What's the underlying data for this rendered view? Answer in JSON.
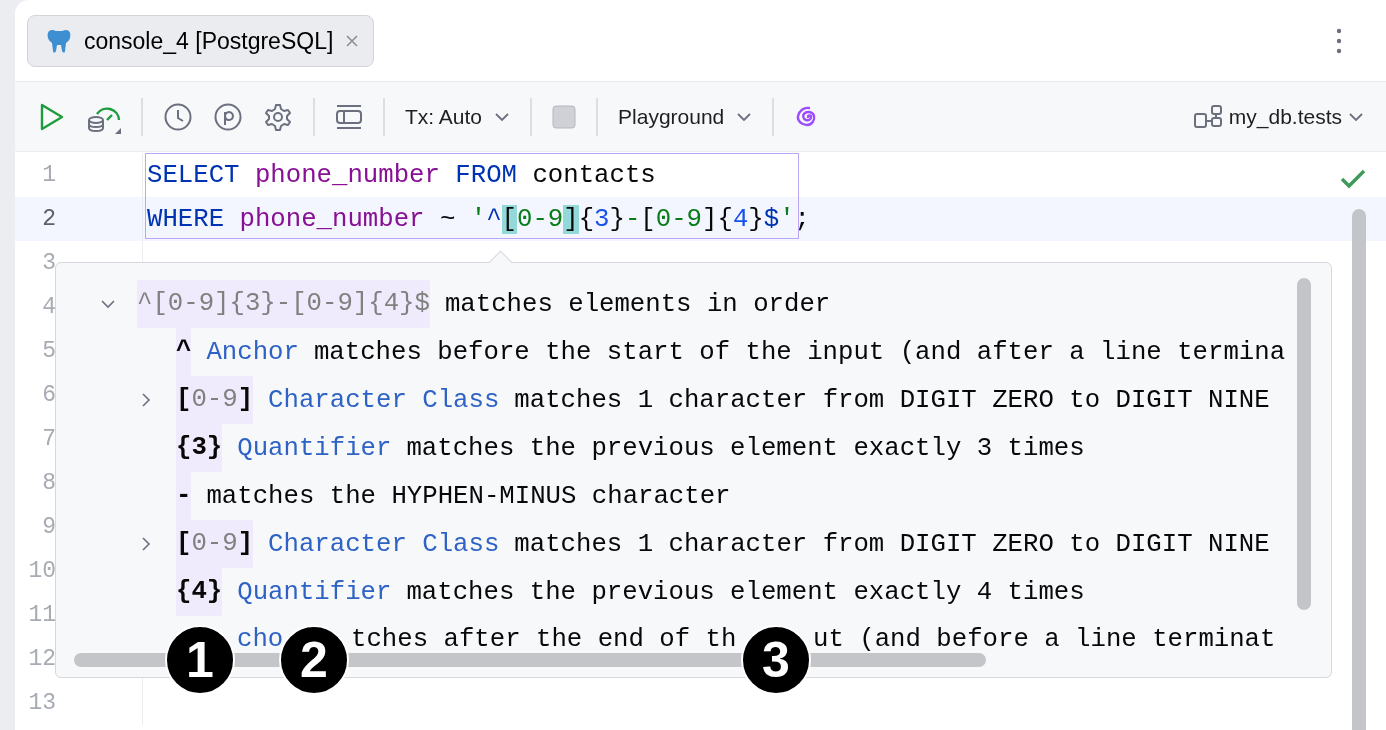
{
  "tab": {
    "title": "console_4 [PostgreSQL]",
    "selected": true
  },
  "toolbar": {
    "tx_mode": "Tx: Auto",
    "playground": "Playground",
    "schema": "my_db.tests"
  },
  "editor": {
    "status_ok": true,
    "lines": [
      {
        "number": "1",
        "current": false,
        "tokens": [
          {
            "text": "SELECT ",
            "kind": "keyword"
          },
          {
            "text": "phone_number",
            "kind": "column"
          },
          {
            "text": " FROM ",
            "kind": "keyword"
          },
          {
            "text": "contacts",
            "kind": "plain"
          }
        ]
      },
      {
        "number": "2",
        "current": true,
        "tokens": [
          {
            "text": "WHERE ",
            "kind": "keyword"
          },
          {
            "text": "phone_number",
            "kind": "column"
          },
          {
            "text": " ~ ",
            "kind": "plain"
          },
          {
            "text": "'",
            "kind": "string"
          },
          {
            "text": "^",
            "kind": "meta"
          },
          {
            "text": "[",
            "kind": "plain",
            "highlighted": true
          },
          {
            "text": "0-9",
            "kind": "string"
          },
          {
            "text": "]",
            "kind": "plain",
            "highlighted": true
          },
          {
            "text": "{",
            "kind": "plain"
          },
          {
            "text": "3",
            "kind": "number"
          },
          {
            "text": "}",
            "kind": "plain"
          },
          {
            "text": "-",
            "kind": "string"
          },
          {
            "text": "[",
            "kind": "plain"
          },
          {
            "text": "0-9",
            "kind": "string"
          },
          {
            "text": "]{",
            "kind": "plain"
          },
          {
            "text": "4",
            "kind": "number"
          },
          {
            "text": "}",
            "kind": "plain"
          },
          {
            "text": "$",
            "kind": "meta"
          },
          {
            "text": "'",
            "kind": "string"
          },
          {
            "text": ";",
            "kind": "plain"
          }
        ]
      },
      {
        "number": "3",
        "current": false
      },
      {
        "number": "4",
        "current": false
      },
      {
        "number": "5",
        "current": false
      },
      {
        "number": "6",
        "current": false
      },
      {
        "number": "7",
        "current": false
      },
      {
        "number": "8",
        "current": false
      },
      {
        "number": "9",
        "current": false
      },
      {
        "number": "10",
        "current": false
      },
      {
        "number": "11",
        "current": false
      },
      {
        "number": "12",
        "current": false
      },
      {
        "number": "13",
        "current": false
      }
    ]
  },
  "regex_popup": {
    "root": {
      "token": "^[0-9]{3}-[0-9]{4}$",
      "text": "matches elements in order",
      "expanded": true,
      "children": [
        {
          "token": "^",
          "kind": "plain",
          "label": "Anchor",
          "text": "matches before the start of the input (and after a line termina"
        },
        {
          "token": "[0-9]",
          "kind": "class",
          "label": "Character Class",
          "text": "matches 1 character from DIGIT ZERO to DIGIT NINE",
          "expanded": false
        },
        {
          "token": "{3}",
          "kind": "plain",
          "label": "Quantifier",
          "text": "matches the previous element exactly 3 times"
        },
        {
          "token": "-",
          "kind": "plain",
          "text": "matches the HYPHEN-MINUS character"
        },
        {
          "token": "[0-9]",
          "kind": "class",
          "label": "Character Class",
          "text": "matches 1 character from DIGIT ZERO to DIGIT NINE",
          "expanded": false
        },
        {
          "token": "{4}",
          "kind": "plain",
          "label": "Quantifier",
          "text": "matches the previous element exactly 4 times"
        },
        {
          "kind": "partial",
          "fragments": [
            "cho",
            "tches after the end of th",
            "ut (and before a line terminat"
          ]
        }
      ]
    }
  },
  "callouts": [
    "1",
    "2",
    "3"
  ]
}
